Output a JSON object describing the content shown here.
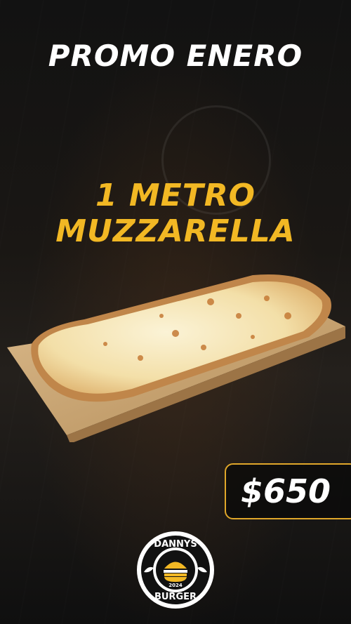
{
  "promo": {
    "title": "PROMO ENERO",
    "product": "1 METRO MUZZARELLA",
    "price": "$650"
  },
  "logo": {
    "top_text": "DANNYS",
    "bottom_text": "BURGER",
    "year": "2024"
  },
  "colors": {
    "accent": "#f2b824",
    "border": "#e0a72a",
    "text": "#ffffff",
    "background": "#0d0d0d"
  }
}
